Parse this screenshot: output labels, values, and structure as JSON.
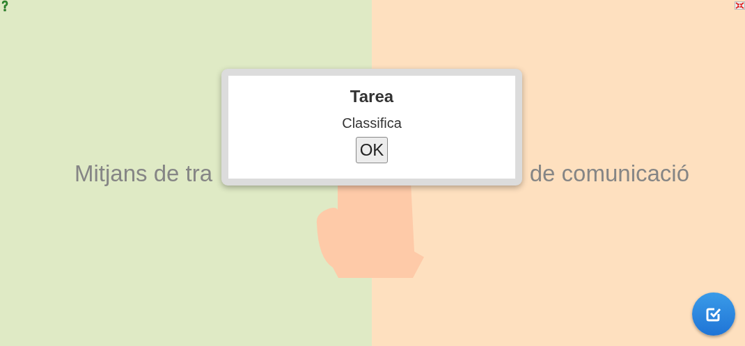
{
  "background_title": {
    "left": "Mitjans de tra",
    "right": "de comunicació"
  },
  "dialog": {
    "title": "Tarea",
    "message": "Classifica",
    "button": "OK"
  }
}
